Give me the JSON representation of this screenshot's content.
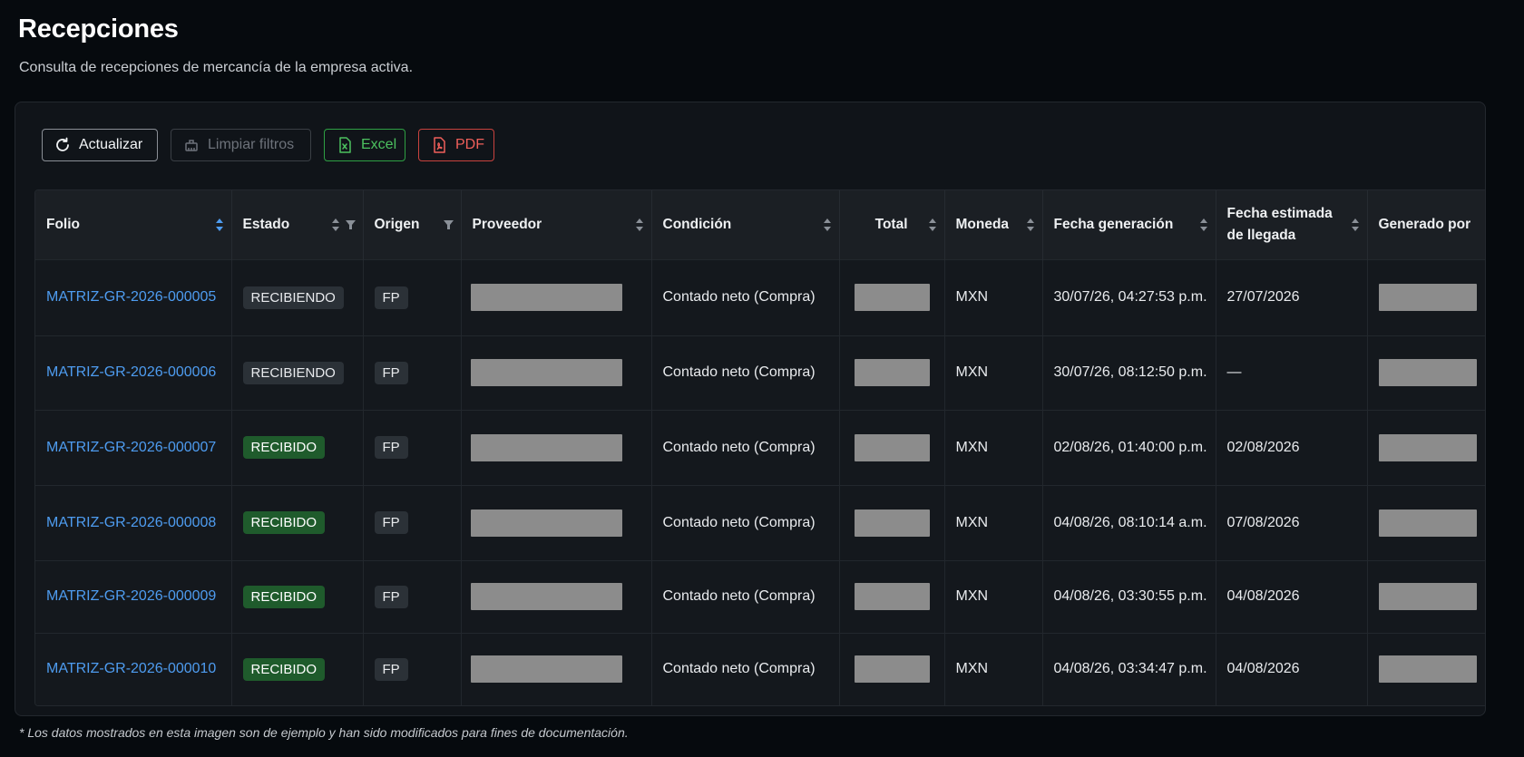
{
  "header": {
    "title": "Recepciones",
    "subtitle": "Consulta de recepciones de mercancía de la empresa activa."
  },
  "toolbar": {
    "refresh_label": "Actualizar",
    "clear_label": "Limpiar filtros",
    "excel_label": "Excel",
    "pdf_label": "PDF"
  },
  "table": {
    "columns": [
      {
        "label": "Folio",
        "sort": "active"
      },
      {
        "label": "Estado",
        "sort": "yes",
        "filter": true
      },
      {
        "label": "Origen",
        "filter": true
      },
      {
        "label": "Proveedor",
        "sort": "yes"
      },
      {
        "label": "Condición",
        "sort": "yes"
      },
      {
        "label": "Total",
        "sort": "yes"
      },
      {
        "label": "Moneda",
        "sort": "yes"
      },
      {
        "label": "Fecha generación",
        "sort": "yes"
      },
      {
        "label": "Fecha estimada de llegada",
        "sort": "yes"
      },
      {
        "label": "Generado por",
        "sort": "yes"
      }
    ],
    "rows": [
      {
        "folio": "MATRIZ-GR-2026-000005",
        "estado": "RECIBIENDO",
        "origen": "FP",
        "condicion": "Contado neto (Compra)",
        "moneda": "MXN",
        "fecha_generacion": "30/07/26, 04:27:53 p.m.",
        "fecha_llegada": "27/07/2026"
      },
      {
        "folio": "MATRIZ-GR-2026-000006",
        "estado": "RECIBIENDO",
        "origen": "FP",
        "condicion": "Contado neto (Compra)",
        "moneda": "MXN",
        "fecha_generacion": "30/07/26, 08:12:50 p.m.",
        "fecha_llegada": "—"
      },
      {
        "folio": "MATRIZ-GR-2026-000007",
        "estado": "RECIBIDO",
        "origen": "FP",
        "condicion": "Contado neto (Compra)",
        "moneda": "MXN",
        "fecha_generacion": "02/08/26, 01:40:00 p.m.",
        "fecha_llegada": "02/08/2026"
      },
      {
        "folio": "MATRIZ-GR-2026-000008",
        "estado": "RECIBIDO",
        "origen": "FP",
        "condicion": "Contado neto (Compra)",
        "moneda": "MXN",
        "fecha_generacion": "04/08/26, 08:10:14 a.m.",
        "fecha_llegada": "07/08/2026"
      },
      {
        "folio": "MATRIZ-GR-2026-000009",
        "estado": "RECIBIDO",
        "origen": "FP",
        "condicion": "Contado neto (Compra)",
        "moneda": "MXN",
        "fecha_generacion": "04/08/26, 03:30:55 p.m.",
        "fecha_llegada": "04/08/2026"
      },
      {
        "folio": "MATRIZ-GR-2026-000010",
        "estado": "RECIBIDO",
        "origen": "FP",
        "condicion": "Contado neto (Compra)",
        "moneda": "MXN",
        "fecha_generacion": "04/08/26, 03:34:47 p.m.",
        "fecha_llegada": "04/08/2026"
      }
    ]
  },
  "footnote": "* Los datos mostrados en esta imagen son de ejemplo y han sido modificados para fines de documentación.",
  "colors": {
    "background": "#060a0e",
    "card": "#101419",
    "link": "#4e9cf0",
    "badge_recibido": "#1f5b2c",
    "badge_recibiendo": "#2b3137",
    "excel": "#2ea043",
    "pdf": "#c9423e"
  },
  "icons": {
    "refresh": "refresh-icon",
    "clear": "broom-icon",
    "excel": "excel-file-icon",
    "pdf": "pdf-file-icon",
    "sort": "sort-icon",
    "filter": "filter-icon"
  }
}
